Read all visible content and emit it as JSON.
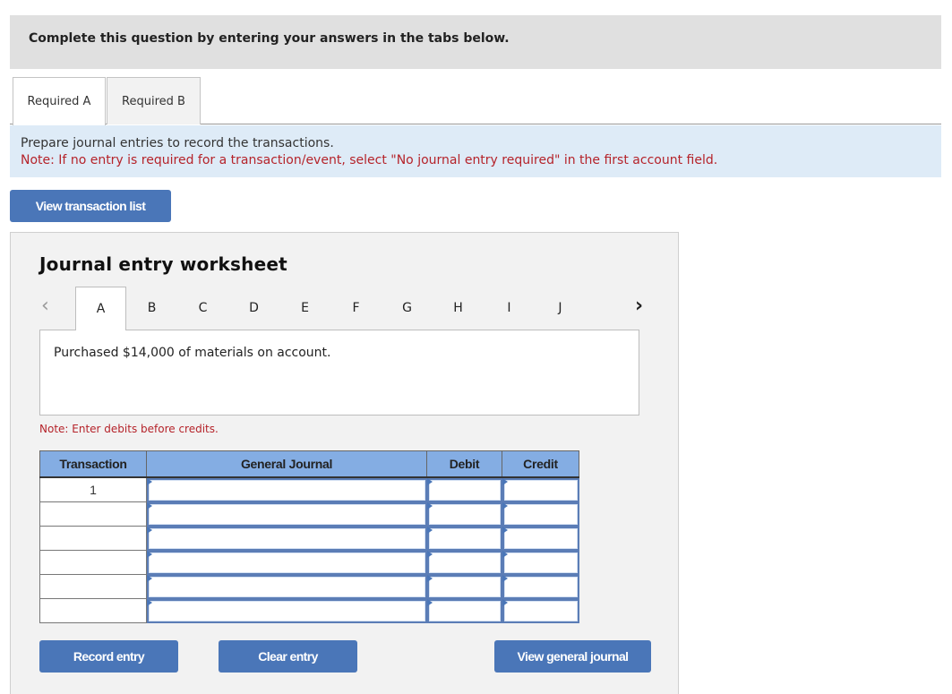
{
  "instruction": "Complete this question by entering your answers in the tabs below.",
  "required_tabs": [
    {
      "label": "Required A",
      "active": true
    },
    {
      "label": "Required B",
      "active": false
    }
  ],
  "prompt": {
    "text": "Prepare journal entries to record the transactions.",
    "note": "Note: If no entry is required for a transaction/event, select \"No journal entry required\" in the first account field."
  },
  "buttons": {
    "view_transaction_list": "View transaction list",
    "record_entry": "Record entry",
    "clear_entry": "Clear entry",
    "view_general_journal": "View general journal"
  },
  "worksheet": {
    "title": "Journal entry worksheet",
    "nav": {
      "prev_icon": "‹",
      "next_icon": "›"
    },
    "letters": [
      {
        "label": "A",
        "active": true
      },
      {
        "label": "B",
        "active": false
      },
      {
        "label": "C",
        "active": false
      },
      {
        "label": "D",
        "active": false
      },
      {
        "label": "E",
        "active": false
      },
      {
        "label": "F",
        "active": false
      },
      {
        "label": "G",
        "active": false
      },
      {
        "label": "H",
        "active": false
      },
      {
        "label": "I",
        "active": false
      },
      {
        "label": "J",
        "active": false
      }
    ],
    "description": "Purchased $14,000 of materials on account.",
    "note": "Note: Enter debits before credits."
  },
  "journal_table": {
    "headers": [
      "Transaction",
      "General Journal",
      "Debit",
      "Credit"
    ],
    "rows": [
      {
        "transaction": "1",
        "account": "",
        "debit": "",
        "credit": ""
      },
      {
        "transaction": "",
        "account": "",
        "debit": "",
        "credit": ""
      },
      {
        "transaction": "",
        "account": "",
        "debit": "",
        "credit": ""
      },
      {
        "transaction": "",
        "account": "",
        "debit": "",
        "credit": ""
      },
      {
        "transaction": "",
        "account": "",
        "debit": "",
        "credit": ""
      },
      {
        "transaction": "",
        "account": "",
        "debit": "",
        "credit": ""
      }
    ]
  }
}
